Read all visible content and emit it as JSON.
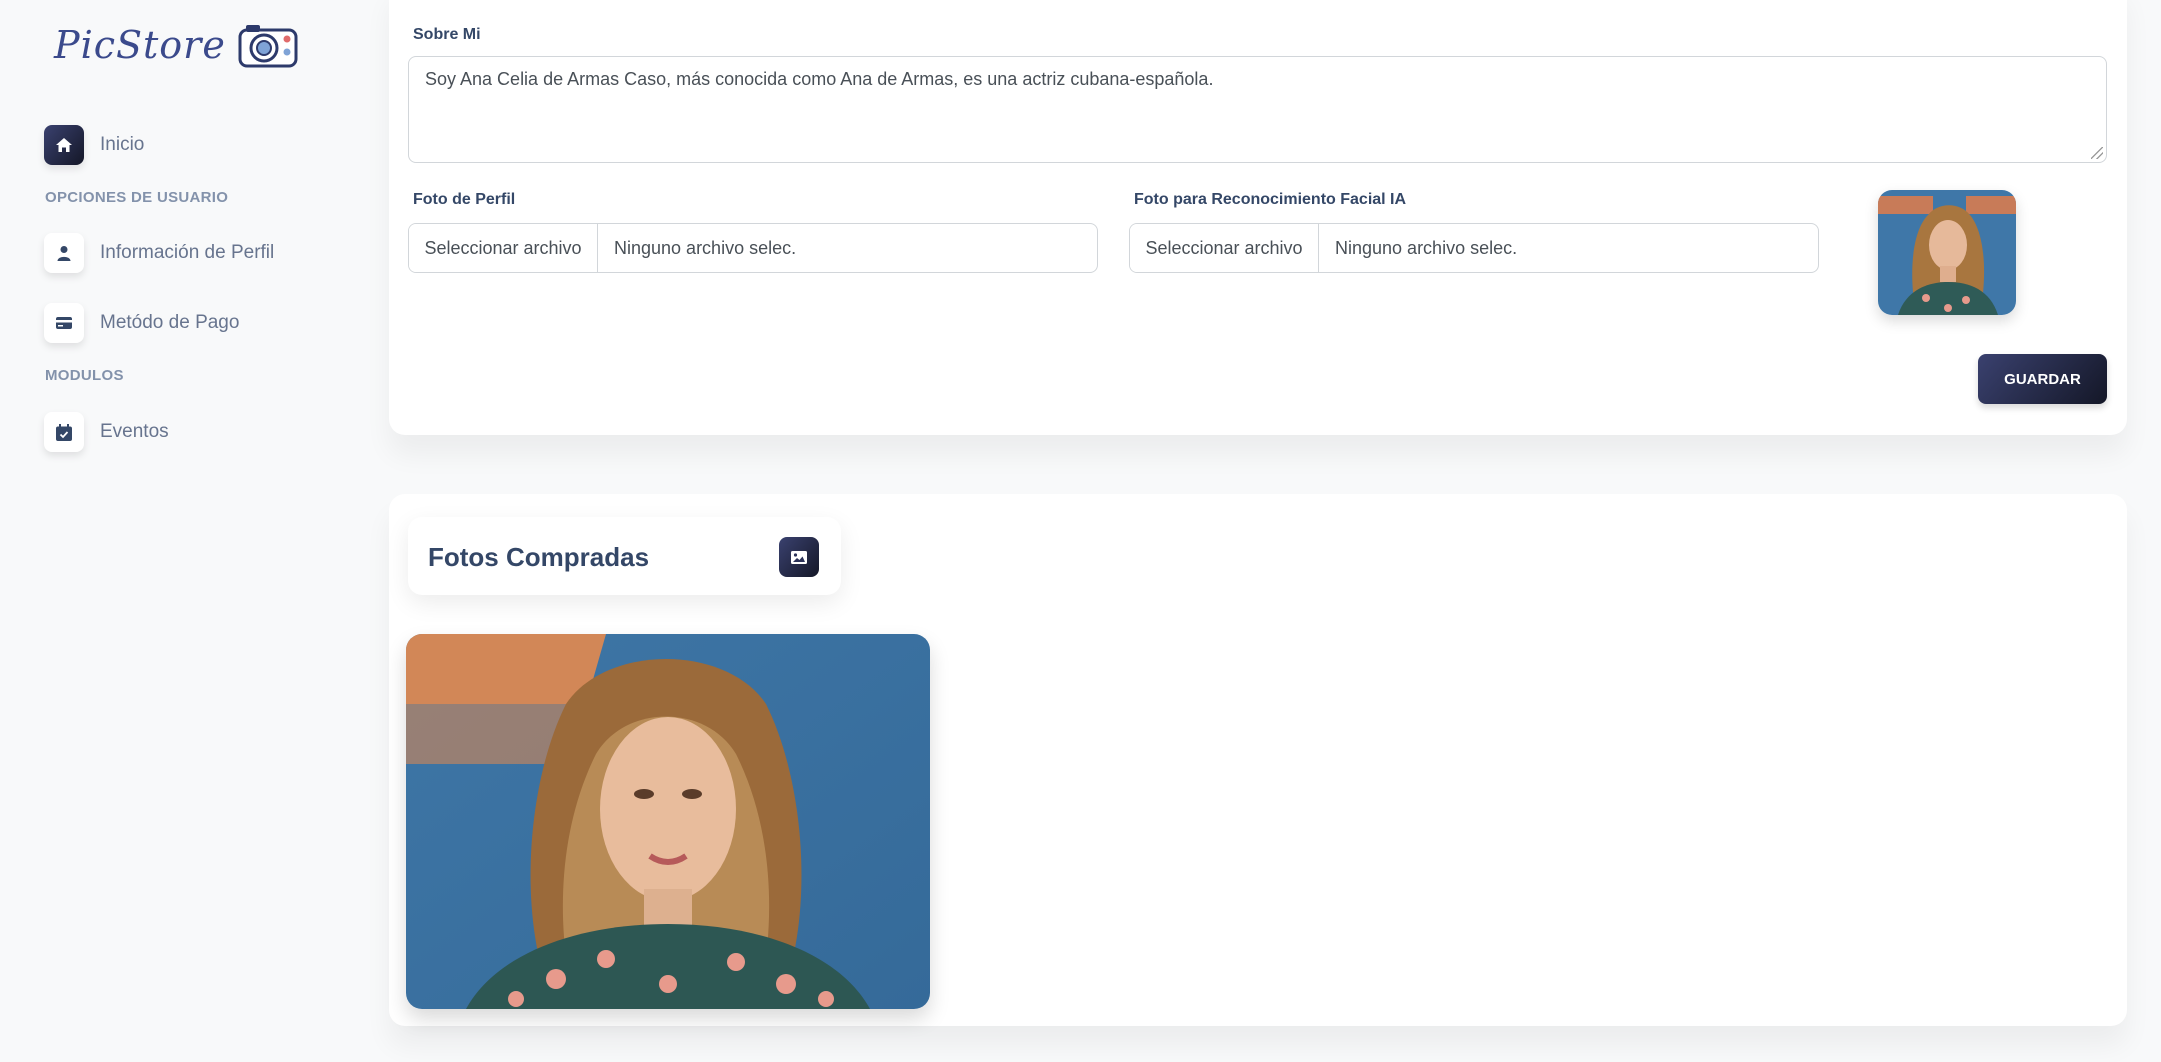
{
  "brand": {
    "name": "PicStore"
  },
  "sidebar": {
    "items": [
      {
        "label": "Inicio",
        "icon": "home-icon",
        "active": true
      },
      {
        "label": "Información de Perfil",
        "icon": "user-icon"
      },
      {
        "label": "Metódo de Pago",
        "icon": "credit-card-icon"
      },
      {
        "label": "Eventos",
        "icon": "calendar-check-icon"
      }
    ],
    "sections": [
      "OPCIONES DE USUARIO",
      "MODULOS"
    ]
  },
  "profile_form": {
    "about_label": "Sobre Mi",
    "about_value": "Soy Ana Celia de Armas Caso, más conocida como Ana de Armas, es una actriz cubana-española.",
    "profile_photo_label": "Foto de Perfil",
    "face_photo_label": "Foto para Reconocimiento Facial IA",
    "file_button_label": "Seleccionar archivo",
    "file_none_text": "Ninguno archivo selec.",
    "save_label": "GUARDAR"
  },
  "purchased": {
    "title": "Fotos Compradas",
    "icon": "image-icon"
  },
  "colors": {
    "accent_dark": "#141727",
    "accent_mid": "#3a416f",
    "text_heading": "#344767",
    "text_body": "#67748e",
    "background": "#f8f9fa"
  }
}
